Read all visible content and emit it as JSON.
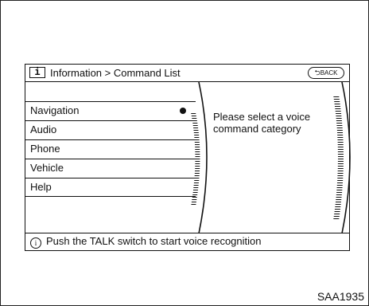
{
  "header": {
    "info_icon_label": "i",
    "title": "Information > Command List",
    "back_label": "BACK"
  },
  "menu": {
    "items": [
      {
        "label": "Navigation",
        "selected": true
      },
      {
        "label": "Audio"
      },
      {
        "label": "Phone"
      },
      {
        "label": "Vehicle"
      },
      {
        "label": "Help"
      }
    ]
  },
  "prompt": {
    "text": "Please select a voice command category"
  },
  "footer": {
    "icon_label": "i",
    "text": "Push the TALK switch to start voice recognition"
  },
  "caption": "SAA1935",
  "icons": {
    "info": "info-icon",
    "back": "back-arrow-icon",
    "footer_info": "info-circle-icon"
  }
}
